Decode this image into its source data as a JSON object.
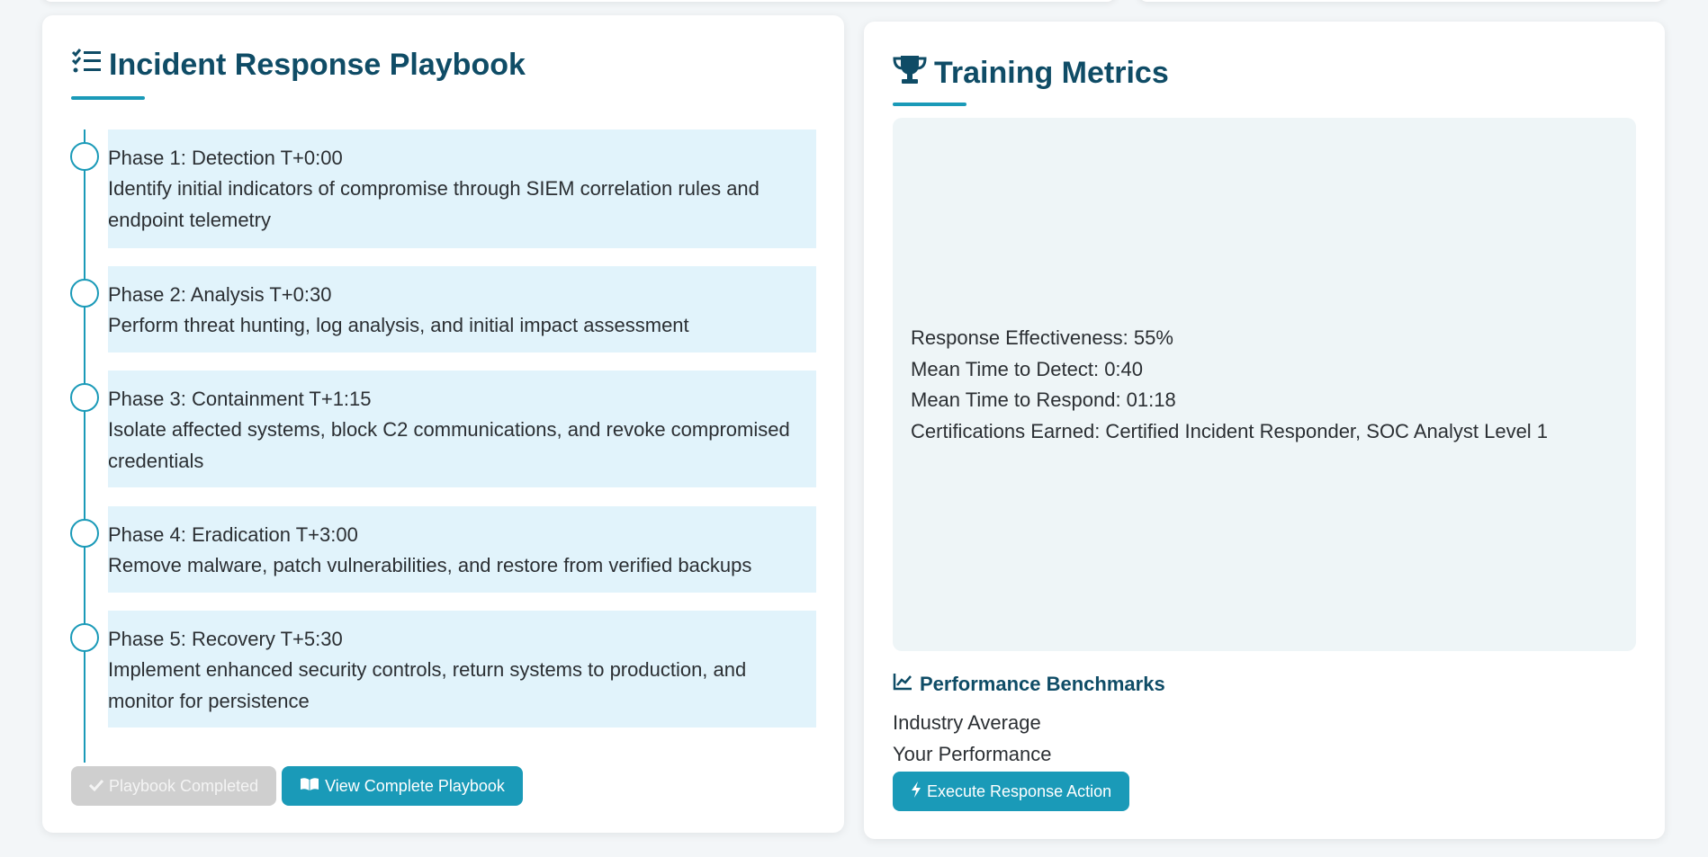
{
  "playbook": {
    "title": "Incident Response Playbook",
    "phases": [
      {
        "head": "Phase 1: Detection T+0:00",
        "desc": "Identify initial indicators of compromise through SIEM correlation rules and endpoint telemetry"
      },
      {
        "head": "Phase 2: Analysis T+0:30",
        "desc": "Perform threat hunting, log analysis, and initial impact assessment"
      },
      {
        "head": "Phase 3: Containment T+1:15",
        "desc": "Isolate affected systems, block C2 communications, and revoke compromised credentials"
      },
      {
        "head": "Phase 4: Eradication T+3:00",
        "desc": "Remove malware, patch vulnerabilities, and restore from verified backups"
      },
      {
        "head": "Phase 5: Recovery T+5:30",
        "desc": "Implement enhanced security controls, return systems to production, and monitor for persistence"
      }
    ],
    "completed_button": "Playbook Completed",
    "view_button": "View Complete Playbook"
  },
  "metrics": {
    "title": "Training Metrics",
    "lines": [
      "Response Effectiveness: 55%",
      "Mean Time to Detect: 0:40",
      "Mean Time to Respond: 01:18",
      "Certifications Earned: Certified Incident Responder, SOC Analyst Level 1"
    ],
    "benchmarks_title": "Performance Benchmarks",
    "industry_average": "Industry Average",
    "your_performance": "Your Performance",
    "execute_button": "Execute Response Action"
  },
  "icons": {
    "playbook": "checklist-icon",
    "metrics": "trophy-icon",
    "benchmarks": "line-chart-icon",
    "completed": "check-icon",
    "view": "book-open-icon",
    "execute": "bolt-icon"
  },
  "colors": {
    "accent": "#1a9ab8",
    "heading": "#0f4c66",
    "phase_bg": "#e1f3fb",
    "metrics_bg": "#eef5f7",
    "disabled": "#cfcfcf"
  }
}
